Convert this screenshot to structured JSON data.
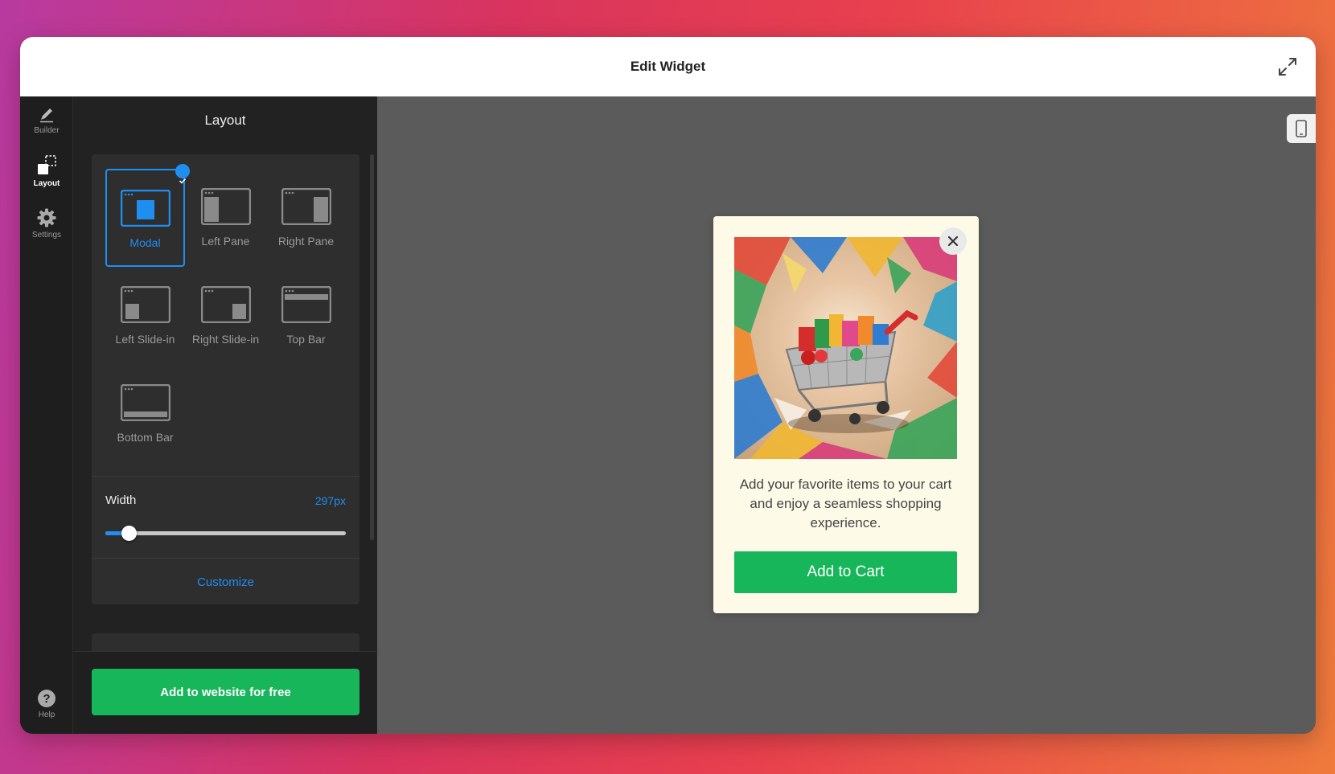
{
  "window": {
    "title": "Edit Widget"
  },
  "rail": {
    "items": [
      {
        "label": "Builder",
        "icon": "pencil-icon"
      },
      {
        "label": "Layout",
        "icon": "layout-icon",
        "active": true
      },
      {
        "label": "Settings",
        "icon": "gear-icon"
      }
    ],
    "help_label": "Help"
  },
  "panel": {
    "title": "Layout",
    "layouts": [
      {
        "label": "Modal",
        "selected": true
      },
      {
        "label": "Left Pane"
      },
      {
        "label": "Right Pane"
      },
      {
        "label": "Left Slide-in"
      },
      {
        "label": "Right Slide-in"
      },
      {
        "label": "Top Bar"
      },
      {
        "label": "Bottom Bar"
      }
    ],
    "width_label": "Width",
    "width_value": "297px",
    "width_slider_fraction": 0.1,
    "customize_label": "Customize",
    "add_button": "Add to website for free"
  },
  "preview": {
    "modal_text": "Add your favorite items to your cart and enjoy a seamless shopping experience.",
    "cta_label": "Add to Cart"
  },
  "colors": {
    "accent": "#1f8ef1",
    "cta_green": "#17b65a",
    "modal_bg": "#fdfbe8",
    "preview_bg": "#5b5b5b"
  }
}
